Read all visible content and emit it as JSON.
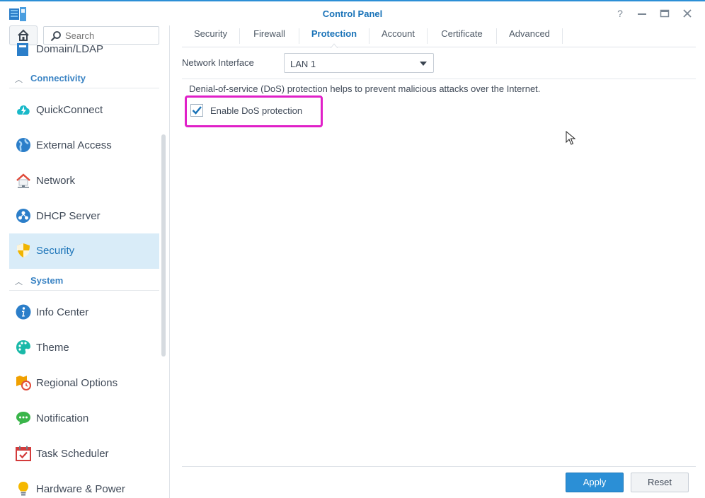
{
  "window": {
    "title": "Control Panel"
  },
  "sidebar": {
    "search_placeholder": "Search",
    "items": [
      {
        "label": "Domain/LDAP",
        "icon": "domain-ldap-icon"
      },
      {
        "label": "QuickConnect",
        "icon": "quickconnect-icon"
      },
      {
        "label": "External Access",
        "icon": "globe-icon"
      },
      {
        "label": "Network",
        "icon": "house-network-icon"
      },
      {
        "label": "DHCP Server",
        "icon": "dhcp-icon"
      },
      {
        "label": "Security",
        "icon": "shield-icon",
        "active": true
      },
      {
        "label": "Info Center",
        "icon": "info-icon"
      },
      {
        "label": "Theme",
        "icon": "palette-icon"
      },
      {
        "label": "Regional Options",
        "icon": "regional-clock-icon"
      },
      {
        "label": "Notification",
        "icon": "chat-bubble-icon"
      },
      {
        "label": "Task Scheduler",
        "icon": "calendar-check-icon"
      },
      {
        "label": "Hardware & Power",
        "icon": "lightbulb-icon"
      }
    ],
    "groups": [
      {
        "label": "Connectivity"
      },
      {
        "label": "System"
      }
    ]
  },
  "tabs": [
    {
      "label": "Security"
    },
    {
      "label": "Firewall"
    },
    {
      "label": "Protection",
      "active": true
    },
    {
      "label": "Account"
    },
    {
      "label": "Certificate"
    },
    {
      "label": "Advanced"
    }
  ],
  "form": {
    "network_interface_label": "Network Interface",
    "network_interface_value": "LAN 1",
    "description": "Denial-of-service (DoS) protection helps to prevent malicious attacks over the Internet.",
    "dos_checkbox_label": "Enable DoS protection",
    "dos_checkbox_checked": true
  },
  "footer": {
    "apply_label": "Apply",
    "reset_label": "Reset"
  },
  "colors": {
    "accent": "#2b8fd6",
    "highlight": "#e020c8",
    "active_bg": "#d9ecf8"
  }
}
